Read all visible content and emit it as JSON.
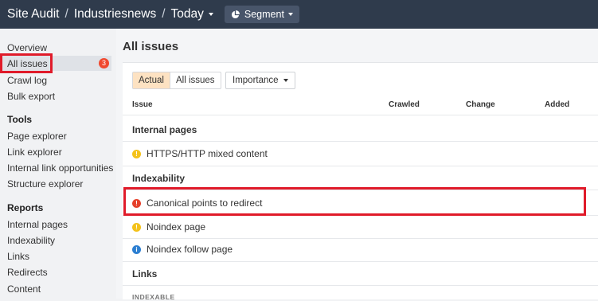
{
  "header": {
    "crumbs": [
      "Site Audit",
      "Industriesnews",
      "Today"
    ],
    "separator": "/",
    "segment_label": "Segment"
  },
  "sidebar": {
    "items_top": [
      {
        "label": "Overview"
      },
      {
        "label": "All issues",
        "badge": "3",
        "active": true
      },
      {
        "label": "Crawl log"
      },
      {
        "label": "Bulk export"
      }
    ],
    "tools": {
      "heading": "Tools",
      "items": [
        "Page explorer",
        "Link explorer",
        "Internal link opportunities",
        "Structure explorer"
      ]
    },
    "reports": {
      "heading": "Reports",
      "items": [
        "Internal pages",
        "Indexability",
        "Links",
        "Redirects",
        "Content"
      ]
    }
  },
  "main": {
    "title": "All issues",
    "filters": {
      "actual": "Actual",
      "all": "All issues",
      "importance": "Importance"
    },
    "columns": [
      "Issue",
      "Crawled",
      "Change",
      "Added"
    ],
    "groups": [
      {
        "title": "Internal pages",
        "issues": [
          {
            "label": "HTTPS/HTTP mixed content",
            "severity": "warning"
          }
        ]
      },
      {
        "title": "Indexability",
        "issues": [
          {
            "label": "Canonical points to redirect",
            "severity": "error"
          },
          {
            "label": "Noindex page",
            "severity": "warning"
          },
          {
            "label": "Noindex follow page",
            "severity": "notice"
          }
        ]
      },
      {
        "title": "Links",
        "subheading": "INDEXABLE"
      }
    ]
  },
  "colors": {
    "topbar": "#2f3b4c",
    "highlight": "#e01b2a",
    "badge": "#f0492f",
    "active_filter": "#fde2c2"
  }
}
